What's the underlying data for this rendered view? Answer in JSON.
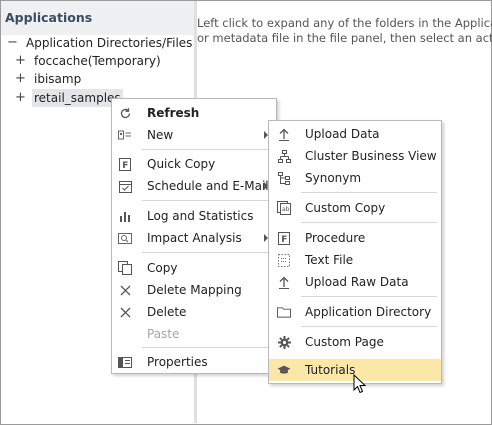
{
  "panel": {
    "title": "Applications"
  },
  "tree": {
    "root": {
      "toggle": "−",
      "label": "Application Directories/Files"
    },
    "items": [
      {
        "toggle": "+",
        "label": "foccache(Temporary)"
      },
      {
        "toggle": "+",
        "label": "ibisamp"
      },
      {
        "toggle": "+",
        "label": "retail_samples"
      }
    ]
  },
  "main": {
    "line1": "Left click to expand any of the folders in the Applicatio",
    "line2": "or metadata file in the file panel, then select an action f"
  },
  "context_menu": {
    "items": [
      {
        "label": "Refresh",
        "icon": "refresh-icon"
      },
      {
        "label": "New",
        "icon": "new-icon"
      },
      {
        "label": "Quick Copy",
        "icon": "quick-copy-icon"
      },
      {
        "label": "Schedule and E-Mail",
        "icon": "calendar-icon"
      },
      {
        "label": "Log and Statistics",
        "icon": "bar-chart-icon"
      },
      {
        "label": "Impact Analysis",
        "icon": "impact-analysis-icon"
      },
      {
        "label": "Copy",
        "icon": "copy-icon"
      },
      {
        "label": "Delete Mapping",
        "icon": "delete-mapping-icon"
      },
      {
        "label": "Delete",
        "icon": "delete-icon"
      },
      {
        "label": "Paste",
        "icon": ""
      },
      {
        "label": "Properties",
        "icon": "properties-icon"
      }
    ]
  },
  "submenu": {
    "items": [
      {
        "label": "Upload Data",
        "icon": "upload-icon"
      },
      {
        "label": "Cluster Business View",
        "icon": "cluster-icon"
      },
      {
        "label": "Synonym",
        "icon": "synonym-icon"
      },
      {
        "label": "Custom Copy",
        "icon": "custom-copy-icon"
      },
      {
        "label": "Procedure",
        "icon": "procedure-icon"
      },
      {
        "label": "Text File",
        "icon": "text-file-icon"
      },
      {
        "label": "Upload Raw Data",
        "icon": "upload-raw-icon"
      },
      {
        "label": "Application Directory",
        "icon": "folder-icon"
      },
      {
        "label": "Custom Page",
        "icon": "gear-icon"
      },
      {
        "label": "Tutorials",
        "icon": "graduation-cap-icon"
      }
    ]
  },
  "colors": {
    "highlight": "#fbe8a8",
    "header_bg": "#eef0f2",
    "header_text": "#3b4c61"
  }
}
